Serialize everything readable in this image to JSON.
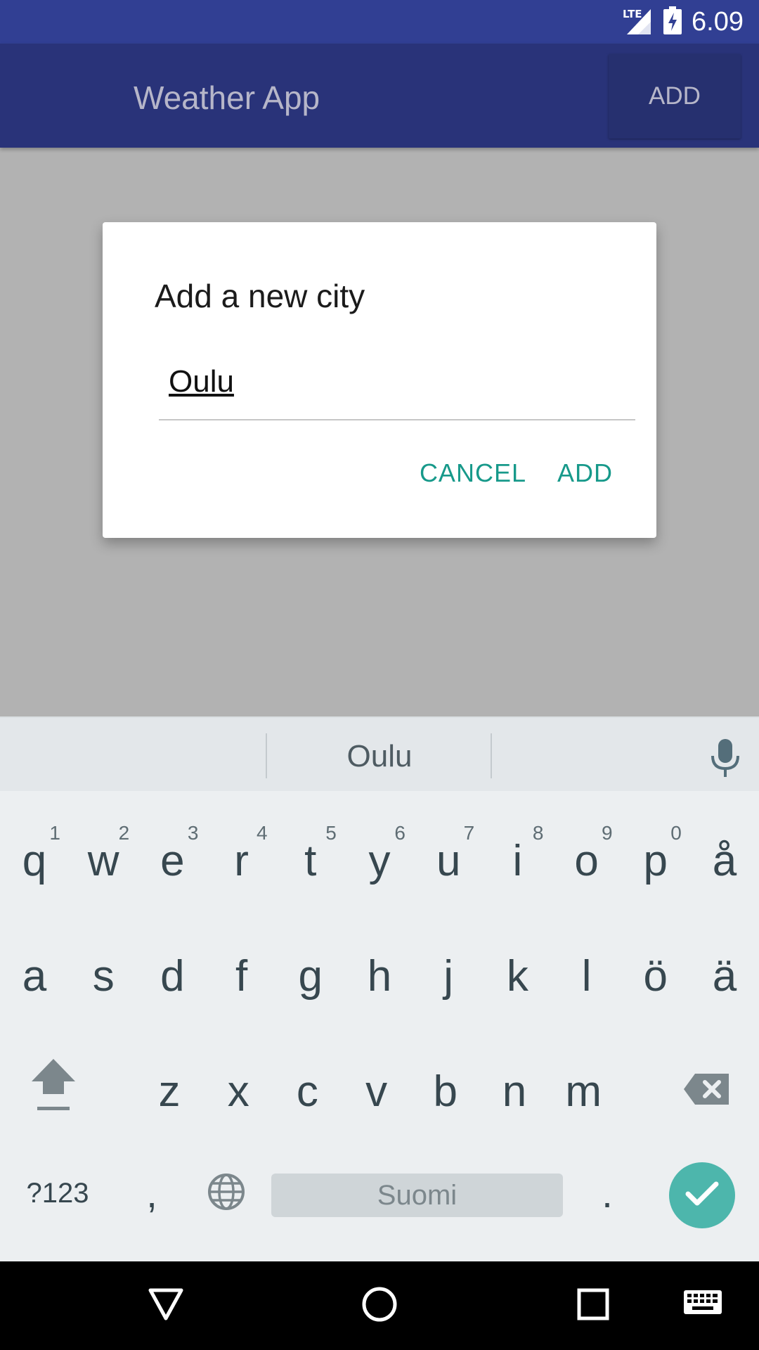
{
  "status": {
    "network": "LTE",
    "time": "6.09"
  },
  "appbar": {
    "title": "Weather App",
    "add_label": "ADD"
  },
  "dialog": {
    "title": "Add a new city",
    "input_value": "Oulu",
    "cancel_label": "CANCEL",
    "add_label": "ADD"
  },
  "keyboard": {
    "suggestion": "Oulu",
    "row1": [
      {
        "key": "q",
        "num": "1"
      },
      {
        "key": "w",
        "num": "2"
      },
      {
        "key": "e",
        "num": "3"
      },
      {
        "key": "r",
        "num": "4"
      },
      {
        "key": "t",
        "num": "5"
      },
      {
        "key": "y",
        "num": "6"
      },
      {
        "key": "u",
        "num": "7"
      },
      {
        "key": "i",
        "num": "8"
      },
      {
        "key": "o",
        "num": "9"
      },
      {
        "key": "p",
        "num": "0"
      },
      {
        "key": "å",
        "num": ""
      }
    ],
    "row2": [
      "a",
      "s",
      "d",
      "f",
      "g",
      "h",
      "j",
      "k",
      "l",
      "ö",
      "ä"
    ],
    "row3": [
      "z",
      "x",
      "c",
      "v",
      "b",
      "n",
      "m"
    ],
    "symbols_label": "?123",
    "comma": ",",
    "space_label": "Suomi",
    "period": "."
  },
  "icons": {
    "mic": "microphone-icon",
    "shift": "shift-icon",
    "backspace": "backspace-icon",
    "globe": "globe-icon",
    "done": "checkmark-icon",
    "back": "back-icon",
    "home": "home-icon",
    "recents": "recents-icon",
    "keyboard": "keyboard-switch-icon"
  },
  "colors": {
    "statusbar": "#313f93",
    "appbar": "#293379",
    "accent": "#17998a",
    "done_key": "#4db6ac",
    "scrim": "#b2b2b2"
  }
}
